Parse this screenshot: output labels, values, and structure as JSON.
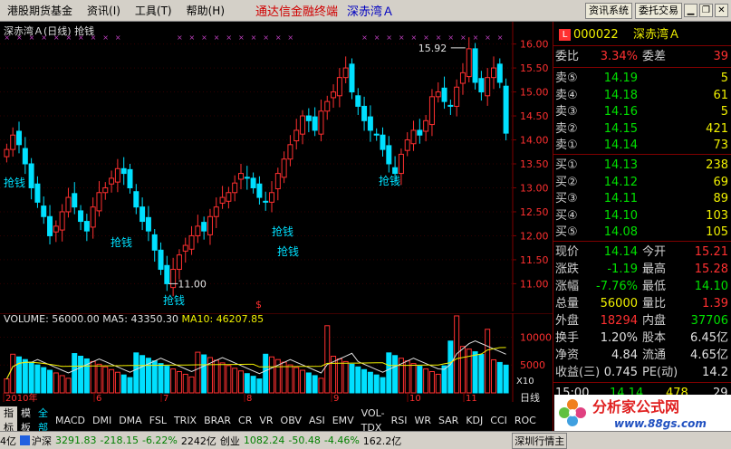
{
  "menubar": {
    "items": [
      "港股期货基金",
      "资讯(I)",
      "工具(T)",
      "帮助(H)"
    ],
    "center_title": "通达信金融终端",
    "stock_title": "深赤湾Ａ",
    "news_button": "资讯系统",
    "order_button": "委托交易"
  },
  "chart": {
    "title": "深赤湾Ａ(日线) 抢钱",
    "annotation_label": "抢钱",
    "high_marker": "15.92",
    "low_marker": "11.00",
    "date_labels": [
      "2010年",
      "6",
      "7",
      "8",
      "9",
      "10",
      "11"
    ],
    "price_axis": [
      "16.00",
      "15.50",
      "15.00",
      "14.50",
      "14.00",
      "13.50",
      "13.00",
      "12.50",
      "12.00",
      "11.50",
      "11.00"
    ],
    "volume_axis": [
      "10000",
      "5000"
    ],
    "volume_unit": "X10",
    "period": "日线",
    "volume_label": "VOLUME: 56000.00",
    "ma5_label": "MA5: 43350.30",
    "ma10_label": "MA10: 46207.85"
  },
  "chart_data": {
    "type": "candlestick",
    "ylim": [
      10.8,
      16.2
    ],
    "closes": [
      13.8,
      14.1,
      13.9,
      13.5,
      13.0,
      12.7,
      12.4,
      12.0,
      12.2,
      12.5,
      12.8,
      12.6,
      12.3,
      12.1,
      12.6,
      12.9,
      13.0,
      13.2,
      13.4,
      13.3,
      13.0,
      12.6,
      12.3,
      12.1,
      11.7,
      11.3,
      11.0,
      11.3,
      11.6,
      11.8,
      12.0,
      12.2,
      12.1,
      12.4,
      12.6,
      12.8,
      12.9,
      13.1,
      13.3,
      13.2,
      13.0,
      12.8,
      12.7,
      12.9,
      13.3,
      13.6,
      13.9,
      14.2,
      14.5,
      14.4,
      14.2,
      14.6,
      14.8,
      15.0,
      15.3,
      15.5,
      15.0,
      14.7,
      14.4,
      14.2,
      14.1,
      13.8,
      13.5,
      13.3,
      13.7,
      14.0,
      14.2,
      14.1,
      14.4,
      14.9,
      15.0,
      14.8,
      14.7,
      15.1,
      15.4,
      15.9,
      15.2,
      15.0,
      15.3,
      15.5,
      15.2,
      14.14
    ]
  },
  "quote": {
    "code_badge": "L",
    "code": "000022",
    "name": "深赤湾Ａ",
    "weibi_label": "委比",
    "weibi_value": "3.34%",
    "weicha_label": "委差",
    "weicha_value": "39",
    "asks": [
      {
        "label": "卖⑤",
        "price": "14.19",
        "vol": "5"
      },
      {
        "label": "卖④",
        "price": "14.18",
        "vol": "61"
      },
      {
        "label": "卖③",
        "price": "14.16",
        "vol": "5"
      },
      {
        "label": "卖②",
        "price": "14.15",
        "vol": "421"
      },
      {
        "label": "卖①",
        "price": "14.14",
        "vol": "73"
      }
    ],
    "bids": [
      {
        "label": "买①",
        "price": "14.13",
        "vol": "238"
      },
      {
        "label": "买②",
        "price": "14.12",
        "vol": "69"
      },
      {
        "label": "买③",
        "price": "14.11",
        "vol": "89"
      },
      {
        "label": "买④",
        "price": "14.10",
        "vol": "103"
      },
      {
        "label": "买⑤",
        "price": "14.08",
        "vol": "105"
      }
    ],
    "stats": [
      {
        "l1": "现价",
        "v1": "14.14",
        "c1": "green",
        "l2": "今开",
        "v2": "15.21",
        "c2": "red"
      },
      {
        "l1": "涨跌",
        "v1": "-1.19",
        "c1": "green",
        "l2": "最高",
        "v2": "15.28",
        "c2": "red"
      },
      {
        "l1": "涨幅",
        "v1": "-7.76%",
        "c1": "green",
        "l2": "最低",
        "v2": "14.10",
        "c2": "green"
      },
      {
        "l1": "总量",
        "v1": "56000",
        "c1": "yellow",
        "l2": "量比",
        "v2": "1.39",
        "c2": "red"
      },
      {
        "l1": "外盘",
        "v1": "18294",
        "c1": "red",
        "l2": "内盘",
        "v2": "37706",
        "c2": "green"
      },
      {
        "l1": "换手",
        "v1": "1.20%",
        "c1": "white",
        "l2": "股本",
        "v2": "6.45亿",
        "c2": "white"
      },
      {
        "l1": "净资",
        "v1": "4.84",
        "c1": "white",
        "l2": "流通",
        "v2": "4.65亿",
        "c2": "white"
      },
      {
        "l1": "收益(三)",
        "v1": "0.745",
        "c1": "white",
        "l2": "PE(动)",
        "v2": "14.2",
        "c2": "white"
      }
    ],
    "tick_time": "15:00",
    "tick_price": "14.14",
    "tick_vol": "478",
    "tick_count": "29"
  },
  "tabs": [
    "指标",
    "模板",
    "全部",
    "MACD",
    "DMI",
    "DMA",
    "FSL",
    "TRIX",
    "BRAR",
    "CR",
    "VR",
    "OBV",
    "ASI",
    "EMV",
    "VOL-TDX",
    "RSI",
    "WR",
    "SAR",
    "KDJ",
    "CCI",
    "ROC"
  ],
  "status": {
    "prefix": "4亿",
    "hs_label": "沪深",
    "hs_value": "3291.83",
    "hs_change": "-218.15",
    "hs_pct": "-6.22%",
    "hs_amount": "2242亿",
    "cy_label": "创业",
    "cy_value": "1082.24",
    "cy_change": "-50.48",
    "cy_pct": "-4.46%",
    "cy_amount": "162.2亿",
    "right_label": "深圳行情主"
  },
  "logo": {
    "text": "分析家公式网",
    "url": "www.88gs.com"
  },
  "colors": {
    "up": "#ff3030",
    "down": "#00e0ff",
    "ma5": "#e0e0e0",
    "ma10": "#f0f000",
    "grid": "#800000"
  }
}
